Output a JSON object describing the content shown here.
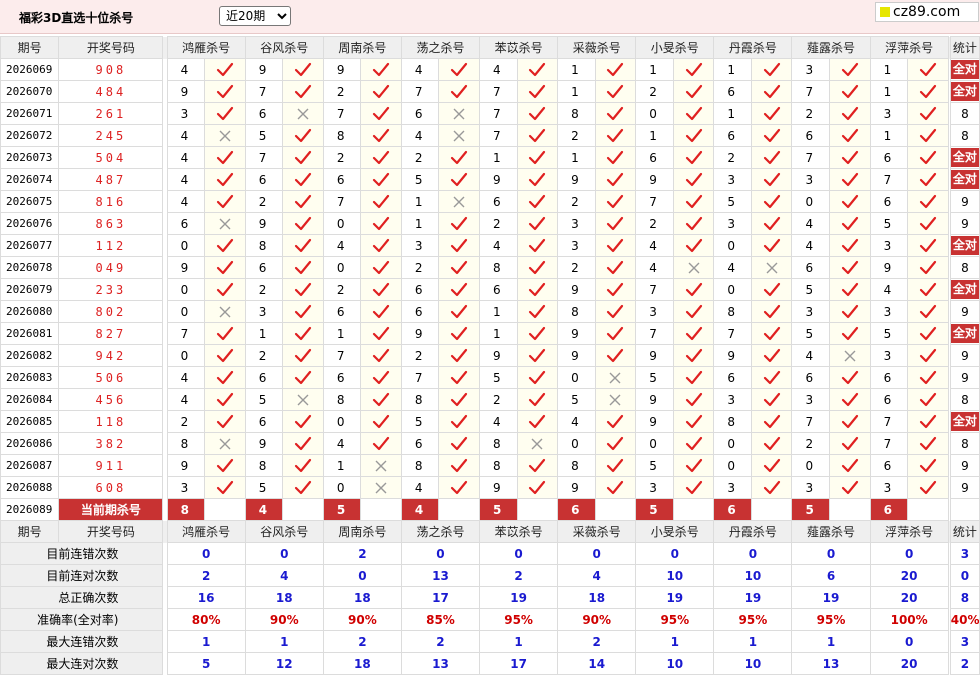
{
  "page": {
    "title": "福彩3D直选十位杀号",
    "period_selected": "近20期",
    "site_logo": "cz89.com"
  },
  "header": {
    "issue": "期号",
    "draw": "开奖号码",
    "stat": "统计",
    "current_label": "当前期杀号"
  },
  "experts": [
    "鸿雁杀号",
    "谷风杀号",
    "周南杀号",
    "荡之杀号",
    "苯苡杀号",
    "采薇杀号",
    "小旻杀号",
    "丹霞杀号",
    "薤露杀号",
    "浮萍杀号"
  ],
  "all_correct_label": "全对",
  "rows": [
    {
      "issue": "2026069",
      "draw": "908",
      "picks": [
        4,
        9,
        9,
        4,
        4,
        1,
        1,
        1,
        3,
        1
      ],
      "ok": [
        1,
        1,
        1,
        1,
        1,
        1,
        1,
        1,
        1,
        1
      ],
      "stat": "全对"
    },
    {
      "issue": "2026070",
      "draw": "484",
      "picks": [
        9,
        7,
        2,
        7,
        7,
        1,
        2,
        6,
        7,
        1
      ],
      "ok": [
        1,
        1,
        1,
        1,
        1,
        1,
        1,
        1,
        1,
        1
      ],
      "stat": "全对"
    },
    {
      "issue": "2026071",
      "draw": "261",
      "picks": [
        3,
        6,
        7,
        6,
        7,
        8,
        0,
        1,
        2,
        3
      ],
      "ok": [
        1,
        0,
        1,
        0,
        1,
        1,
        1,
        1,
        1,
        1
      ],
      "stat": "8"
    },
    {
      "issue": "2026072",
      "draw": "245",
      "picks": [
        4,
        5,
        8,
        4,
        7,
        2,
        1,
        6,
        6,
        1
      ],
      "ok": [
        0,
        1,
        1,
        0,
        1,
        1,
        1,
        1,
        1,
        1
      ],
      "stat": "8"
    },
    {
      "issue": "2026073",
      "draw": "504",
      "picks": [
        4,
        7,
        2,
        2,
        1,
        1,
        6,
        2,
        7,
        6
      ],
      "ok": [
        1,
        1,
        1,
        1,
        1,
        1,
        1,
        1,
        1,
        1
      ],
      "stat": "全对"
    },
    {
      "issue": "2026074",
      "draw": "487",
      "picks": [
        4,
        6,
        6,
        5,
        9,
        9,
        9,
        3,
        3,
        7
      ],
      "ok": [
        1,
        1,
        1,
        1,
        1,
        1,
        1,
        1,
        1,
        1
      ],
      "stat": "全对"
    },
    {
      "issue": "2026075",
      "draw": "816",
      "picks": [
        4,
        2,
        7,
        1,
        6,
        2,
        7,
        5,
        0,
        6
      ],
      "ok": [
        1,
        1,
        1,
        0,
        1,
        1,
        1,
        1,
        1,
        1
      ],
      "stat": "9"
    },
    {
      "issue": "2026076",
      "draw": "863",
      "picks": [
        6,
        9,
        0,
        1,
        2,
        3,
        2,
        3,
        4,
        5
      ],
      "ok": [
        0,
        1,
        1,
        1,
        1,
        1,
        1,
        1,
        1,
        1
      ],
      "stat": "9"
    },
    {
      "issue": "2026077",
      "draw": "112",
      "picks": [
        0,
        8,
        4,
        3,
        4,
        3,
        4,
        0,
        4,
        3
      ],
      "ok": [
        1,
        1,
        1,
        1,
        1,
        1,
        1,
        1,
        1,
        1
      ],
      "stat": "全对"
    },
    {
      "issue": "2026078",
      "draw": "049",
      "picks": [
        9,
        6,
        0,
        2,
        8,
        2,
        4,
        4,
        6,
        9
      ],
      "ok": [
        1,
        1,
        1,
        1,
        1,
        1,
        0,
        0,
        1,
        1
      ],
      "stat": "8"
    },
    {
      "issue": "2026079",
      "draw": "233",
      "picks": [
        0,
        2,
        2,
        6,
        6,
        9,
        7,
        0,
        5,
        4
      ],
      "ok": [
        1,
        1,
        1,
        1,
        1,
        1,
        1,
        1,
        1,
        1
      ],
      "stat": "全对"
    },
    {
      "issue": "2026080",
      "draw": "802",
      "picks": [
        0,
        3,
        6,
        6,
        1,
        8,
        3,
        8,
        3,
        3
      ],
      "ok": [
        0,
        1,
        1,
        1,
        1,
        1,
        1,
        1,
        1,
        1
      ],
      "stat": "9"
    },
    {
      "issue": "2026081",
      "draw": "827",
      "picks": [
        7,
        1,
        1,
        9,
        1,
        9,
        7,
        7,
        5,
        5
      ],
      "ok": [
        1,
        1,
        1,
        1,
        1,
        1,
        1,
        1,
        1,
        1
      ],
      "stat": "全对"
    },
    {
      "issue": "2026082",
      "draw": "942",
      "picks": [
        0,
        2,
        7,
        2,
        9,
        9,
        9,
        9,
        4,
        3
      ],
      "ok": [
        1,
        1,
        1,
        1,
        1,
        1,
        1,
        1,
        0,
        1
      ],
      "stat": "9"
    },
    {
      "issue": "2026083",
      "draw": "506",
      "picks": [
        4,
        6,
        6,
        7,
        5,
        0,
        5,
        6,
        6,
        6
      ],
      "ok": [
        1,
        1,
        1,
        1,
        1,
        0,
        1,
        1,
        1,
        1
      ],
      "stat": "9"
    },
    {
      "issue": "2026084",
      "draw": "456",
      "picks": [
        4,
        5,
        8,
        8,
        2,
        5,
        9,
        3,
        3,
        6
      ],
      "ok": [
        1,
        0,
        1,
        1,
        1,
        0,
        1,
        1,
        1,
        1
      ],
      "stat": "8"
    },
    {
      "issue": "2026085",
      "draw": "118",
      "picks": [
        2,
        6,
        0,
        5,
        4,
        4,
        9,
        8,
        7,
        7
      ],
      "ok": [
        1,
        1,
        1,
        1,
        1,
        1,
        1,
        1,
        1,
        1
      ],
      "stat": "全对"
    },
    {
      "issue": "2026086",
      "draw": "382",
      "picks": [
        8,
        9,
        4,
        6,
        8,
        0,
        0,
        0,
        2,
        7
      ],
      "ok": [
        0,
        1,
        1,
        1,
        0,
        1,
        1,
        1,
        1,
        1
      ],
      "stat": "8"
    },
    {
      "issue": "2026087",
      "draw": "911",
      "picks": [
        9,
        8,
        1,
        8,
        8,
        8,
        5,
        0,
        0,
        6
      ],
      "ok": [
        1,
        1,
        0,
        1,
        1,
        1,
        1,
        1,
        1,
        1
      ],
      "stat": "9"
    },
    {
      "issue": "2026088",
      "draw": "608",
      "picks": [
        3,
        5,
        0,
        4,
        9,
        9,
        3,
        3,
        3,
        3
      ],
      "ok": [
        1,
        1,
        0,
        1,
        1,
        1,
        1,
        1,
        1,
        1
      ],
      "stat": "9"
    }
  ],
  "current": {
    "issue": "2026089",
    "picks": [
      8,
      4,
      5,
      4,
      5,
      6,
      5,
      6,
      5,
      6
    ]
  },
  "summary": [
    {
      "label": "目前连错次数",
      "values": [
        "0",
        "0",
        "2",
        "0",
        "0",
        "0",
        "0",
        "0",
        "0",
        "0"
      ],
      "stat": "3",
      "pct": false
    },
    {
      "label": "目前连对次数",
      "values": [
        "2",
        "4",
        "0",
        "13",
        "2",
        "4",
        "10",
        "10",
        "6",
        "20"
      ],
      "stat": "0",
      "pct": false
    },
    {
      "label": "总正确次数",
      "values": [
        "16",
        "18",
        "18",
        "17",
        "19",
        "18",
        "19",
        "19",
        "19",
        "20"
      ],
      "stat": "8",
      "pct": false
    },
    {
      "label": "准确率(全对率)",
      "values": [
        "80%",
        "90%",
        "90%",
        "85%",
        "95%",
        "90%",
        "95%",
        "95%",
        "95%",
        "100%"
      ],
      "stat": "40%",
      "pct": true
    },
    {
      "label": "最大连错次数",
      "values": [
        "1",
        "1",
        "2",
        "2",
        "1",
        "2",
        "1",
        "1",
        "1",
        "0"
      ],
      "stat": "3",
      "pct": false
    },
    {
      "label": "最大连对次数",
      "values": [
        "5",
        "12",
        "18",
        "13",
        "17",
        "14",
        "10",
        "10",
        "13",
        "20"
      ],
      "stat": "2",
      "pct": false
    }
  ],
  "colors": {
    "accent_red": "#c83232",
    "draw_red": "#dd2222",
    "value_blue": "#1a1ad0",
    "check_red": "#e02020",
    "cross_gray": "#999999"
  }
}
